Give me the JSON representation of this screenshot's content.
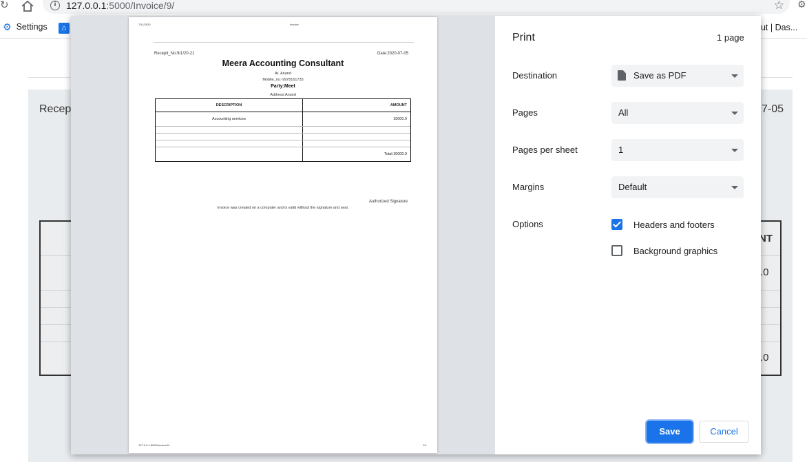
{
  "browser": {
    "url_host": "127.0.0.1",
    "url_path": ":5000/Invoice/9/",
    "bookmarks": {
      "settings_label": "Settings",
      "right_label": "out | Das..."
    }
  },
  "background_page": {
    "receipt_fragment": "Recepi",
    "date_fragment": "7-05",
    "amount_header_fragment": "NT",
    "value1_fragment": ".0",
    "value2_fragment": ".0"
  },
  "preview": {
    "header_date": "7/11/2020",
    "header_title": "Invoice",
    "receipt_no": "Recepit_No:9/1/20-21",
    "date": "Date:2020-07-05",
    "company": "Meera Accounting Consultant",
    "at": "At. Anand",
    "mobile": "Mobile_no:-9978161735",
    "party": "Party:Meet",
    "address": "Address:Anand",
    "table": {
      "col_description": "DESCRIPTION",
      "col_amount": "AMOUNT",
      "row_description": "Accounting services",
      "row_amount": "15000.0",
      "total": "Total:15000.0"
    },
    "signature": "Authorized Signature",
    "note": "Invoice was created on a computer and is valid without the signature and seal.",
    "footer_url": "127.0.0.1:5000/Invoice/9/",
    "footer_page": "1/1"
  },
  "print_settings": {
    "title": "Print",
    "page_count": "1 page",
    "destination_label": "Destination",
    "destination_value": "Save as PDF",
    "pages_label": "Pages",
    "pages_value": "All",
    "pages_per_sheet_label": "Pages per sheet",
    "pages_per_sheet_value": "1",
    "margins_label": "Margins",
    "margins_value": "Default",
    "options_label": "Options",
    "headers_footers_label": "Headers and footers",
    "headers_footers_checked": true,
    "background_graphics_label": "Background graphics",
    "background_graphics_checked": false,
    "save_label": "Save",
    "cancel_label": "Cancel"
  },
  "colors": {
    "accent": "#1a73e8",
    "preview_bg": "#dee1e6",
    "select_bg": "#f1f3f4"
  }
}
